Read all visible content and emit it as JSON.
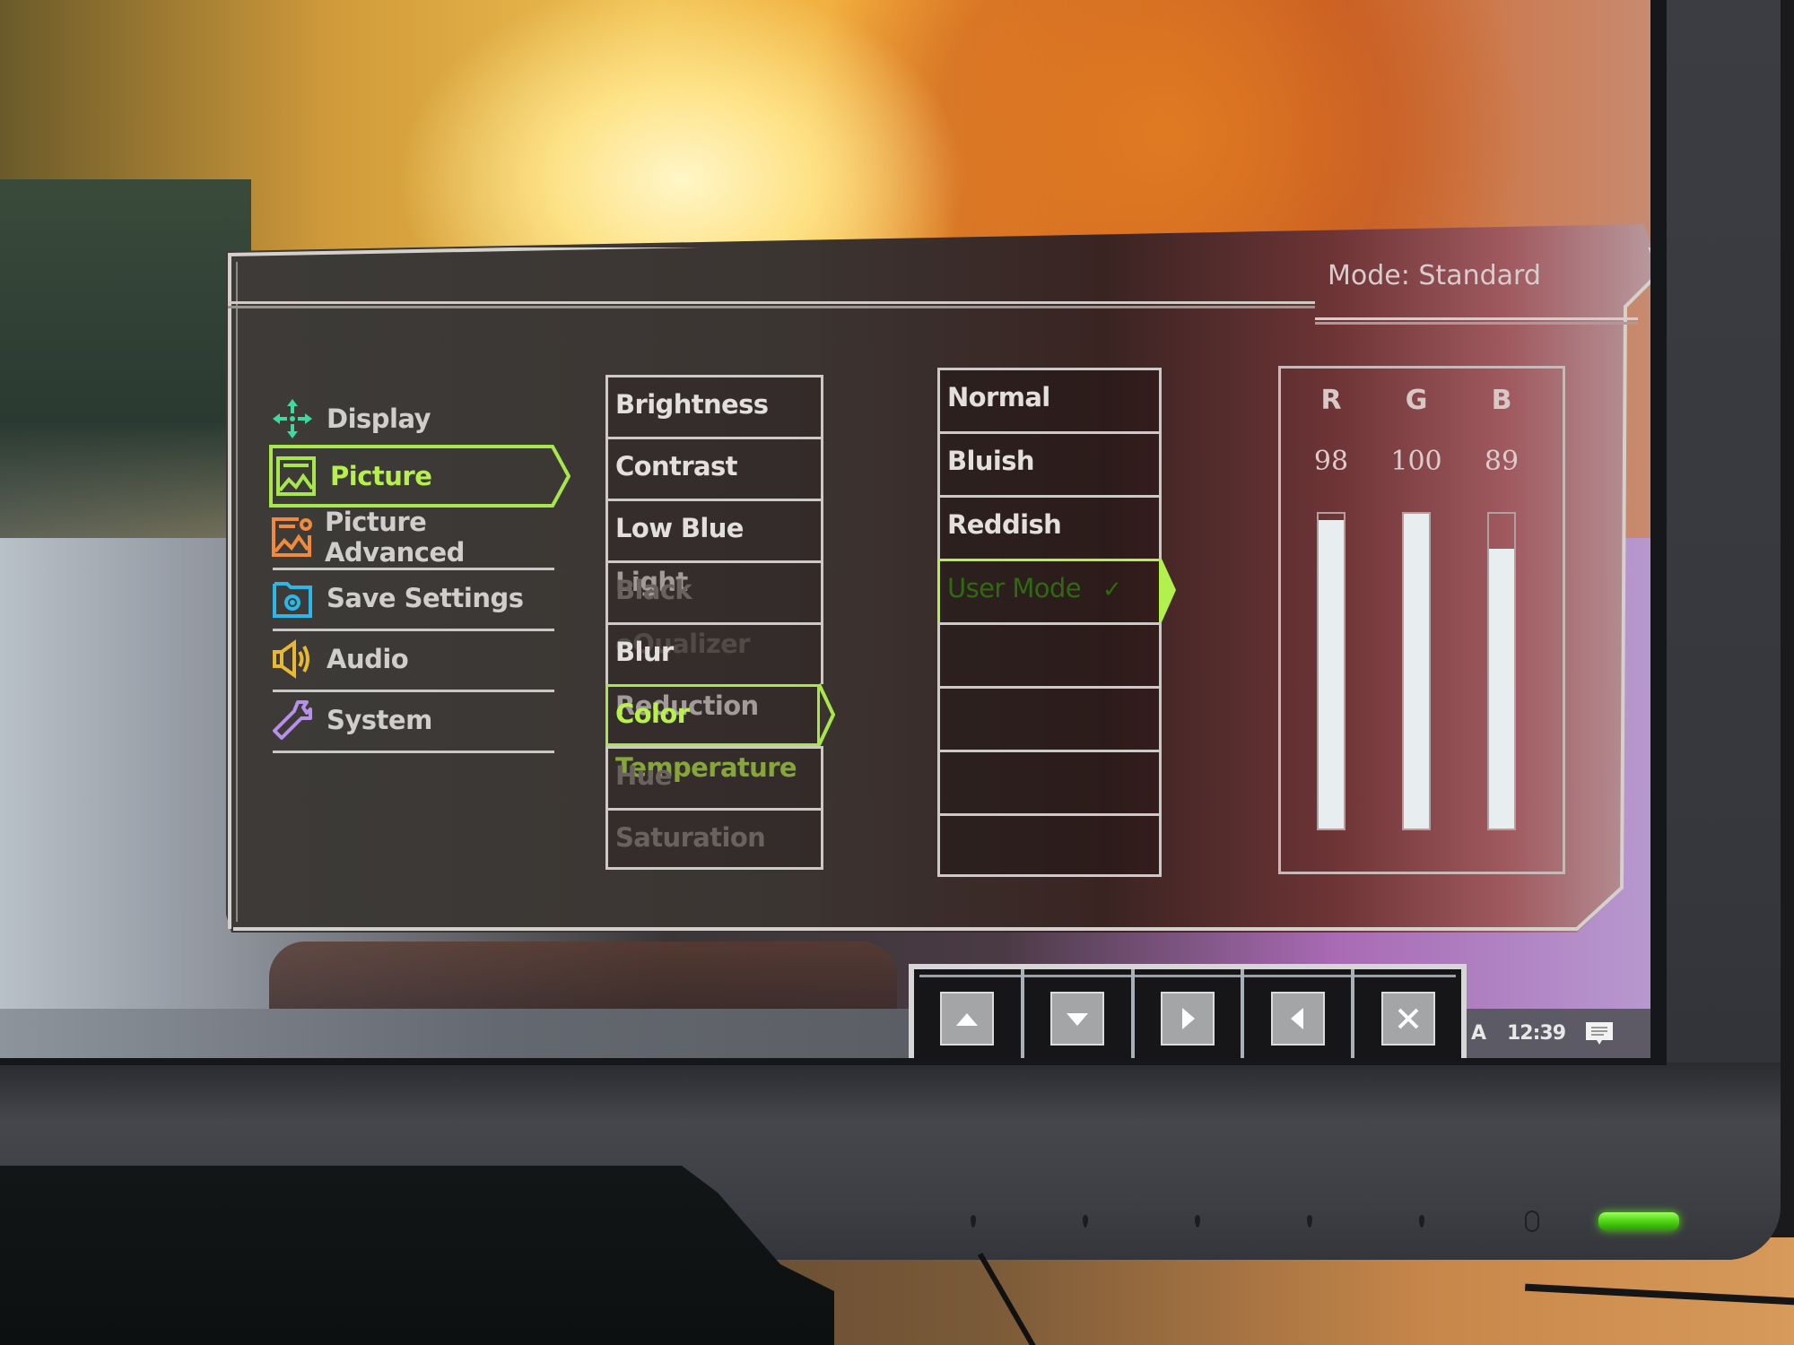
{
  "osd": {
    "mode_label": "Mode: Standard",
    "menu": [
      {
        "label": "Display",
        "icon": "display-icon",
        "color": "#3fd9a0",
        "selected": false
      },
      {
        "label": "Picture",
        "icon": "picture-icon",
        "color": "#a6e84a",
        "selected": true
      },
      {
        "label": "Picture Advanced",
        "icon": "picture-advanced-icon",
        "color": "#f08a3c",
        "selected": false
      },
      {
        "label": "Save Settings",
        "icon": "save-settings-icon",
        "color": "#2bb8e8",
        "selected": false
      },
      {
        "label": "Audio",
        "icon": "audio-icon",
        "color": "#e8b830",
        "selected": false
      },
      {
        "label": "System",
        "icon": "system-icon",
        "color": "#b890e8",
        "selected": false
      }
    ],
    "picture_options": [
      {
        "label": "Brightness",
        "state": "enabled"
      },
      {
        "label": "Contrast",
        "state": "enabled"
      },
      {
        "label": "Low Blue Light",
        "state": "enabled"
      },
      {
        "label": "Black eQualizer",
        "state": "disabled"
      },
      {
        "label": "Blur Reduction",
        "state": "enabled"
      },
      {
        "label": "Color Temperature",
        "state": "selected"
      },
      {
        "label": "Hue",
        "state": "disabled"
      },
      {
        "label": "Saturation",
        "state": "disabled"
      }
    ],
    "color_temperature_options": [
      {
        "label": "Normal",
        "state": "normal"
      },
      {
        "label": "Bluish",
        "state": "normal"
      },
      {
        "label": "Reddish",
        "state": "normal"
      },
      {
        "label": "User Mode",
        "state": "active",
        "check": "✓"
      },
      {
        "label": "",
        "state": "empty"
      },
      {
        "label": "",
        "state": "empty"
      },
      {
        "label": "",
        "state": "empty"
      },
      {
        "label": "",
        "state": "empty"
      }
    ],
    "rgb": {
      "max": 100,
      "channels": [
        {
          "label": "R",
          "value": 98
        },
        {
          "label": "G",
          "value": 100
        },
        {
          "label": "B",
          "value": 89
        }
      ]
    },
    "accent_color": "#b2f14d"
  },
  "nav_buttons": [
    {
      "name": "up",
      "icon": "triangle-up-icon"
    },
    {
      "name": "down",
      "icon": "triangle-down-icon"
    },
    {
      "name": "right",
      "icon": "triangle-right-icon"
    },
    {
      "name": "left",
      "icon": "triangle-left-icon"
    },
    {
      "name": "close",
      "icon": "close-icon"
    }
  ],
  "taskbar": {
    "ime_indicator": "A",
    "clock": "12:39",
    "notification_icon": "action-center-icon"
  },
  "bezel": {
    "power_led_color": "#5ad41c"
  }
}
